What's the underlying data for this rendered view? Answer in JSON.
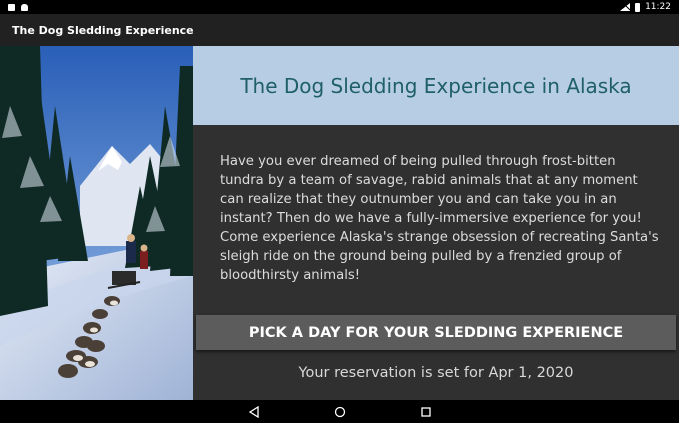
{
  "status_bar": {
    "time": "11:22",
    "left_icons": [
      "notification-icon",
      "android-icon"
    ],
    "right_icons": [
      "no-sim-icon",
      "battery-icon"
    ]
  },
  "app_bar": {
    "title": "The Dog Sledding Experience"
  },
  "main": {
    "hero_image": "alaska-dog-sled-photo",
    "heading": "The Dog Sledding Experience in Alaska",
    "body": "Have you ever dreamed of being pulled through frost-bitten tundra by a team of savage, rabid animals that at any moment can realize that they outnumber you and can take you in an instant? Then do we have a fully-immersive experience for you! Come experience Alaska's strange obsession of recreating Santa's sleigh ride on the ground being pulled by a frenzied group of bloodthirsty animals!",
    "pick_button_label": "PICK A DAY FOR YOUR SLEDDING EXPERIENCE",
    "reservation": "Your reservation is set for Apr 1, 2020"
  },
  "nav_bar": {
    "buttons": [
      "back-icon",
      "home-icon",
      "recents-icon"
    ]
  },
  "colors": {
    "title_box_bg": "#b6cde3",
    "title_text": "#1f5f68",
    "background": "#303030",
    "button_bg": "#5c5c5c"
  }
}
